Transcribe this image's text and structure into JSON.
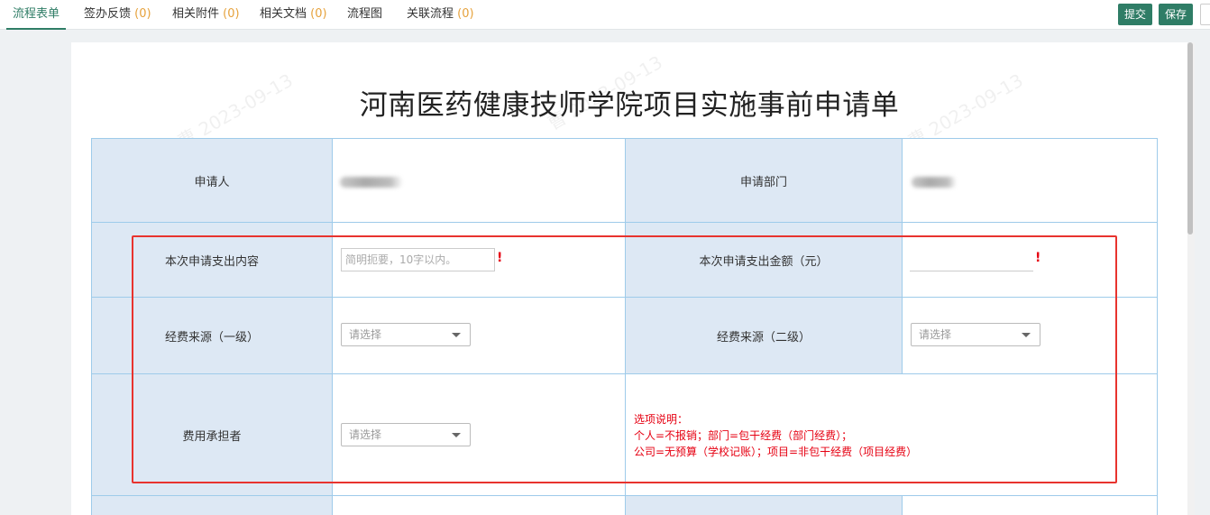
{
  "tabs": [
    {
      "label": "流程表单",
      "count": ""
    },
    {
      "label": "签办反馈",
      "count": "(0)"
    },
    {
      "label": "相关附件",
      "count": "(0)"
    },
    {
      "label": "相关文档",
      "count": "(0)"
    },
    {
      "label": "流程图",
      "count": ""
    },
    {
      "label": "关联流程",
      "count": "(0)"
    }
  ],
  "toolbar": {
    "submit_label": "提交",
    "save_label": "保存"
  },
  "form": {
    "title": "河南医药健康技师学院项目实施事前申请单",
    "watermark": "曹 2023-09-13",
    "applicant_label": "申请人",
    "department_label": "申请部门",
    "content_label": "本次申请支出内容",
    "content_placeholder": "简明扼要，10字以内。",
    "amount_label": "本次申请支出金额（元）",
    "amount_value": "",
    "required_mark": "!",
    "source1_label": "经费来源（一级）",
    "source1_value": "请选择",
    "source2_label": "经费来源（二级）",
    "source2_value": "请选择",
    "bearer_label": "费用承担者",
    "bearer_value": "请选择",
    "note_lines": [
      "选项说明：",
      "个人=不报销；部门=包干经费（部门经费）；",
      "公司=无预算（学校记账）；项目=非包干经费（项目经费）"
    ]
  },
  "colors": {
    "accent": "#2f7d66",
    "label_bg": "#dde8f4",
    "border": "#9ecbea",
    "required": "#e60012",
    "highlight": "#e8332e"
  }
}
